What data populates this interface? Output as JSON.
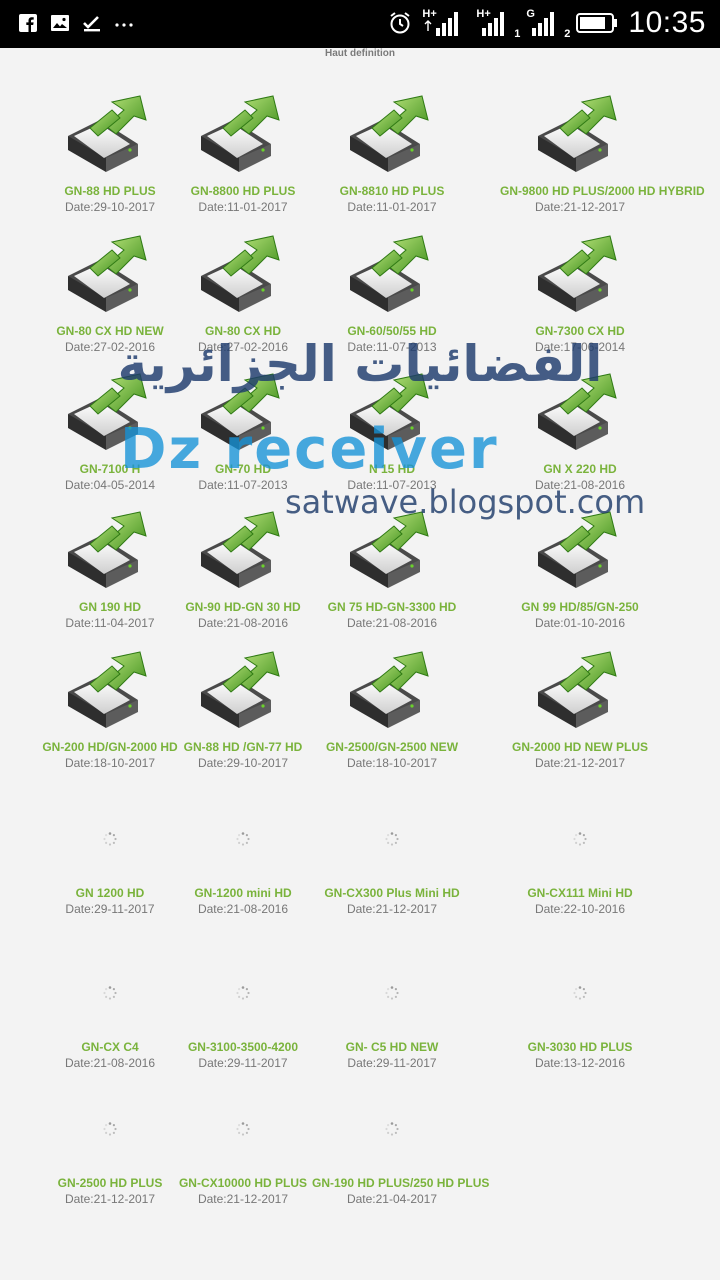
{
  "status_bar": {
    "time": "10:35",
    "net1": "H+",
    "net2": "H+",
    "sim1": "1",
    "net3": "G",
    "sim2": "2",
    "icons": [
      "facebook-icon",
      "gallery-icon",
      "check-icon",
      "more-icon",
      "alarm-icon",
      "signal-icon",
      "battery-icon"
    ]
  },
  "header": {
    "title": "Haut definition"
  },
  "watermark": {
    "arabic": "الفضائيات الجزائرية",
    "brand": "Dz receiver",
    "site": "satwave.blogspot.com"
  },
  "colors": {
    "name": "#7ab33c",
    "date": "#777777",
    "background": "#f3f3f3"
  },
  "items": [
    {
      "name": "GN-88 HD PLUS",
      "date": "Date:29-10-2017",
      "icon": "download-icon"
    },
    {
      "name": "GN-8800 HD PLUS",
      "date": "Date:11-01-2017",
      "icon": "download-icon"
    },
    {
      "name": "GN-8810 HD PLUS",
      "date": "Date:11-01-2017",
      "icon": "download-icon"
    },
    {
      "name": "GN-9800 HD PLUS/2000 HD HYBRID",
      "date": "Date:21-12-2017",
      "icon": "download-icon"
    },
    {
      "name": "GN-80 CX HD NEW",
      "date": "Date:27-02-2016",
      "icon": "download-icon"
    },
    {
      "name": "GN-80 CX HD",
      "date": "Date:27-02-2016",
      "icon": "download-icon"
    },
    {
      "name": "GN-60/50/55 HD",
      "date": "Date:11-07-2013",
      "icon": "download-icon"
    },
    {
      "name": "GN-7300 CX HD",
      "date": "Date:17-06-2014",
      "icon": "download-icon"
    },
    {
      "name": "GN-7100 H",
      "date": "Date:04-05-2014",
      "icon": "download-icon"
    },
    {
      "name": "GN-70 HD",
      "date": "Date:11-07-2013",
      "icon": "download-icon"
    },
    {
      "name": "N 15 HD",
      "date": "Date:11-07-2013",
      "icon": "download-icon"
    },
    {
      "name": "GN X 220 HD",
      "date": "Date:21-08-2016",
      "icon": "download-icon"
    },
    {
      "name": "GN 190 HD",
      "date": "Date:11-04-2017",
      "icon": "download-icon"
    },
    {
      "name": "GN-90 HD-GN 30 HD",
      "date": "Date:21-08-2016",
      "icon": "download-icon"
    },
    {
      "name": "GN 75 HD-GN-3300 HD",
      "date": "Date:21-08-2016",
      "icon": "download-icon"
    },
    {
      "name": "GN 99 HD/85/GN-250",
      "date": "Date:01-10-2016",
      "icon": "download-icon"
    },
    {
      "name": "GN-200 HD/GN-2000 HD",
      "date": "Date:18-10-2017",
      "icon": "download-icon"
    },
    {
      "name": "GN-88 HD /GN-77 HD",
      "date": "Date:29-10-2017",
      "icon": "download-icon"
    },
    {
      "name": "GN-2500/GN-2500 NEW",
      "date": "Date:18-10-2017",
      "icon": "download-icon"
    },
    {
      "name": "GN-2000 HD NEW PLUS",
      "date": "Date:21-12-2017",
      "icon": "download-icon"
    },
    {
      "name": "GN 1200 HD",
      "date": "Date:29-11-2017",
      "icon": "loading-spinner-icon"
    },
    {
      "name": "GN-1200 mini HD",
      "date": "Date:21-08-2016",
      "icon": "loading-spinner-icon"
    },
    {
      "name": "GN-CX300 Plus Mini HD",
      "date": "Date:21-12-2017",
      "icon": "loading-spinner-icon"
    },
    {
      "name": "GN-CX111 Mini HD",
      "date": "Date:22-10-2016",
      "icon": "loading-spinner-icon"
    },
    {
      "name": "GN-CX C4",
      "date": "Date:21-08-2016",
      "icon": "loading-spinner-icon"
    },
    {
      "name": "GN-3100-3500-4200",
      "date": "Date:29-11-2017",
      "icon": "loading-spinner-icon"
    },
    {
      "name": "GN- C5 HD NEW",
      "date": "Date:29-11-2017",
      "icon": "loading-spinner-icon"
    },
    {
      "name": "GN-3030 HD PLUS",
      "date": "Date:13-12-2016",
      "icon": "loading-spinner-icon"
    },
    {
      "name": "GN-2500 HD PLUS",
      "date": "Date:21-12-2017",
      "icon": "loading-spinner-icon"
    },
    {
      "name": "GN-CX10000 HD PLUS",
      "date": "Date:21-12-2017",
      "icon": "loading-spinner-icon"
    },
    {
      "name": "GN-190 HD PLUS/250 HD PLUS",
      "date": "Date:21-04-2017",
      "icon": "loading-spinner-icon"
    }
  ]
}
